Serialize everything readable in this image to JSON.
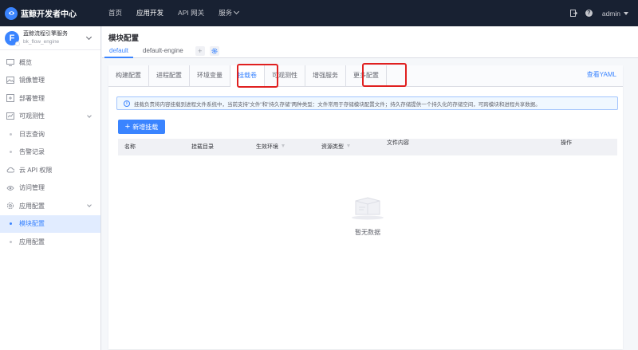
{
  "topbar": {
    "brand": "蓝鲸开发者中心",
    "nav": [
      "首页",
      "应用开发",
      "API 网关",
      "服务"
    ],
    "active_nav": "应用开发",
    "user": "admin",
    "help": "?"
  },
  "sidebar": {
    "app_logo_letter": "F",
    "app_name": "蓝鲸流程引擎服务",
    "app_code": "bk_flow_engine",
    "items": [
      {
        "label": "概览"
      },
      {
        "label": "镜像管理"
      },
      {
        "label": "部署管理"
      },
      {
        "label": "可观测性"
      },
      {
        "label": "日志查询"
      },
      {
        "label": "告警记录"
      },
      {
        "label": "云 API 权限"
      },
      {
        "label": "访问管理"
      },
      {
        "label": "应用配置"
      },
      {
        "label": "模块配置"
      },
      {
        "label": "应用配置"
      }
    ]
  },
  "page": {
    "title": "模块配置",
    "module_tabs": [
      "default",
      "default-engine"
    ],
    "add_module": "+"
  },
  "tabs": [
    "构建配置",
    "进程配置",
    "环境变量",
    "挂载卷",
    "可观测性",
    "增强服务",
    "更多配置"
  ],
  "active_tab": "挂载卷",
  "view_yaml": "查看YAML",
  "notice": "挂载负责将内容挂载到进程文件系统中，当前支持\"文件\"和\"持久存储\"两种类型：文件常用于存储模块配置文件；持久存储提供一个持久化的存储空间，可跨模块和进程共享数据。",
  "notice_icon": "i",
  "add_button": {
    "plus": "+",
    "label": "新增挂载"
  },
  "table": {
    "headers": [
      "名称",
      "挂载目录",
      "生效环境",
      "资源类型",
      "文件内容",
      "操作"
    ],
    "empty_text": "暂无数据"
  },
  "colors": {
    "primary": "#3a84ff",
    "topbar": "#182132",
    "highlight": "#e02020"
  }
}
